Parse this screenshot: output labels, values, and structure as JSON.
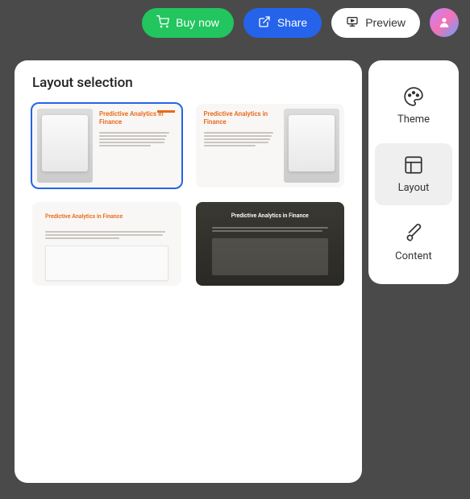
{
  "topbar": {
    "buy_label": "Buy now",
    "share_label": "Share",
    "preview_label": "Preview"
  },
  "panel": {
    "title": "Layout selection"
  },
  "layouts": {
    "card1_title": "Predictive Analytics in Finance",
    "card2_title": "Predictive Analytics in Finance",
    "card3_title": "Predictive Analytics in Finance",
    "card4_title": "Predictive Analytics in Finance"
  },
  "sidebar": {
    "theme_label": "Theme",
    "layout_label": "Layout",
    "content_label": "Content"
  }
}
